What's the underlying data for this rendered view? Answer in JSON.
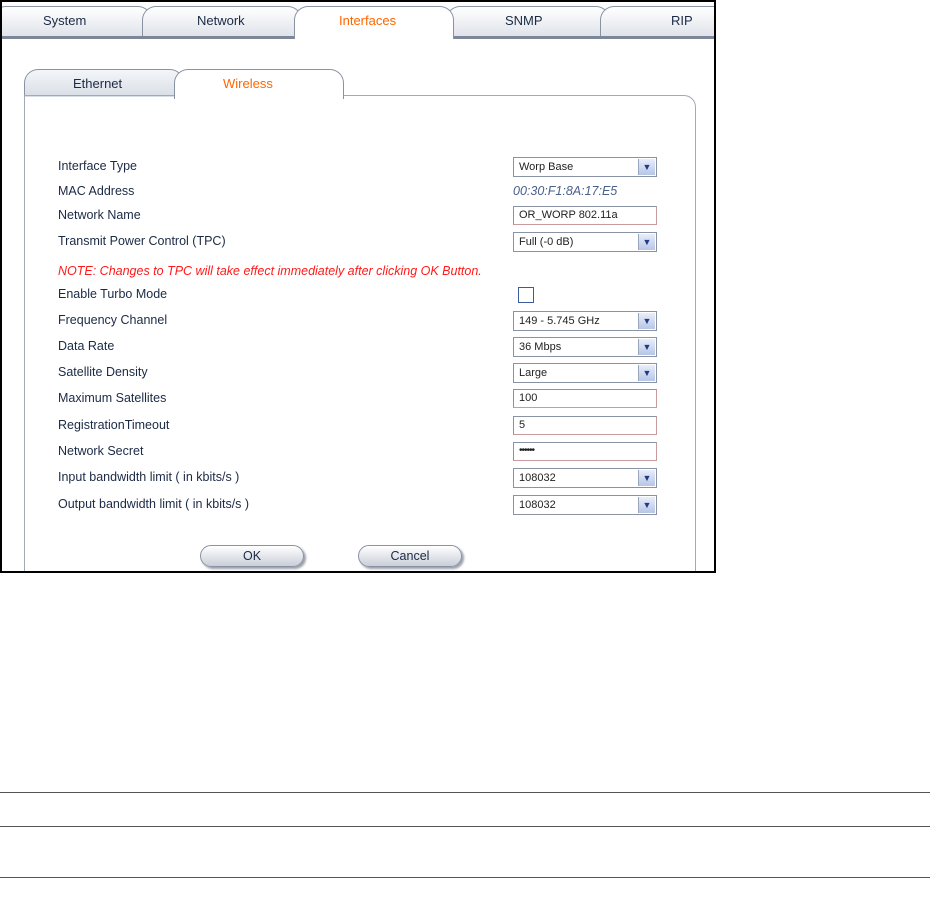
{
  "top_tabs": [
    "System",
    "Network",
    "Interfaces",
    "SNMP",
    "RIP"
  ],
  "sub_tabs": [
    "Ethernet",
    "Wireless"
  ],
  "form": {
    "interface_type": {
      "label": "Interface Type",
      "value": "Worp Base"
    },
    "mac_address": {
      "label": "MAC Address",
      "value": "00:30:F1:8A:17:E5"
    },
    "network_name": {
      "label": "Network Name",
      "value": "OR_WORP 802.11a"
    },
    "tpc": {
      "label": "Transmit Power Control (TPC)",
      "value": "Full (-0 dB)"
    },
    "note": "NOTE: Changes to TPC will take effect immediately after clicking OK Button.",
    "turbo": {
      "label": "Enable Turbo Mode"
    },
    "frequency_channel": {
      "label": "Frequency Channel",
      "value": "149 - 5.745 GHz"
    },
    "data_rate": {
      "label": "Data Rate",
      "value": "36 Mbps"
    },
    "satellite_density": {
      "label": "Satellite Density",
      "value": "Large"
    },
    "max_satellites": {
      "label": "Maximum Satellites",
      "value": "100"
    },
    "registration_timeout": {
      "label": "RegistrationTimeout",
      "value": "5"
    },
    "network_secret": {
      "label": "Network Secret",
      "value": "••••••"
    },
    "input_bw": {
      "label": "Input bandwidth limit ( in kbits/s )",
      "value": "108032"
    },
    "output_bw": {
      "label": "Output bandwidth limit ( in kbits/s )",
      "value": "108032"
    }
  },
  "buttons": {
    "ok": "OK",
    "cancel": "Cancel"
  }
}
